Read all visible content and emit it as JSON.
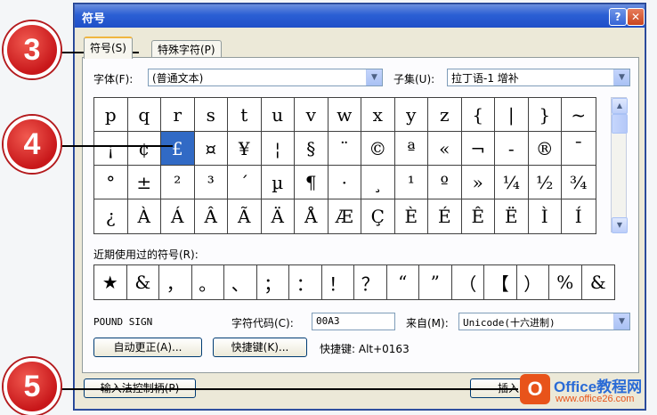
{
  "window": {
    "title": "符号",
    "help_label": "?",
    "close_label": "✕"
  },
  "tabs": [
    {
      "label": "符号(S)"
    },
    {
      "label": "特殊字符(P)"
    }
  ],
  "font": {
    "label": "字体(F):",
    "value": "(普通文本)"
  },
  "subset": {
    "label": "子集(U):",
    "value": "拉丁语-1 增补"
  },
  "symbols": [
    [
      "p",
      "q",
      "r",
      "s",
      "t",
      "u",
      "v",
      "w",
      "x",
      "y",
      "z",
      "{",
      "|",
      "}",
      "~"
    ],
    [
      "¡",
      "¢",
      "£",
      "¤",
      "¥",
      "¦",
      "§",
      "¨",
      "©",
      "ª",
      "«",
      "¬",
      "-",
      "®",
      "¯"
    ],
    [
      "°",
      "±",
      "²",
      "³",
      "´",
      "µ",
      "¶",
      "·",
      "¸",
      "¹",
      "º",
      "»",
      "¼",
      "½",
      "¾"
    ],
    [
      "¿",
      "À",
      "Á",
      "Â",
      "Ã",
      "Ä",
      "Å",
      "Æ",
      "Ç",
      "È",
      "É",
      "Ê",
      "Ë",
      "Ì",
      "Í"
    ]
  ],
  "selected_symbol": "£",
  "recent": {
    "label": "近期使用过的符号(R):",
    "items": [
      "★",
      "&",
      "，",
      "。",
      "、",
      "；",
      "：",
      "！",
      "？",
      "“",
      "”",
      "（",
      "【",
      "）",
      "%",
      "&"
    ]
  },
  "char_name": "POUND SIGN",
  "char_code": {
    "label": "字符代码(C):",
    "value": "00A3"
  },
  "from": {
    "label": "来自(M):",
    "value": "Unicode(十六进制)"
  },
  "buttons": {
    "autocorrect": "自动更正(A)...",
    "shortcut_key": "快捷键(K)...",
    "ime_pad": "输入法控制柄(P)",
    "insert": "插入"
  },
  "shortcut_text": "快捷键: Alt+0163",
  "callouts": [
    "3",
    "4",
    "5"
  ],
  "watermark": {
    "logo_letter": "O",
    "line1": "Office教程网",
    "line2": "www.office26.com"
  },
  "colors": {
    "accent": "#316ac5",
    "titlebar": "#2b5fd4",
    "badge": "#c8171a"
  }
}
